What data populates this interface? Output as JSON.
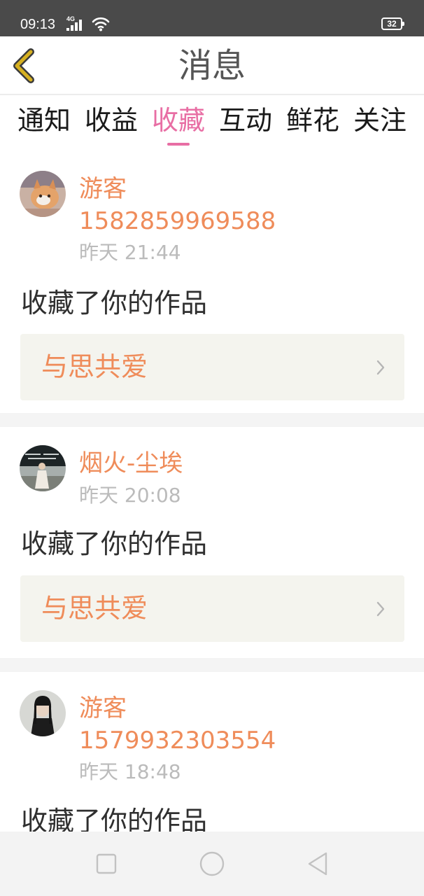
{
  "status_bar": {
    "time": "09:13",
    "network": "4G",
    "battery": "32",
    "icons": [
      "signal-icon",
      "wifi-icon",
      "battery-icon"
    ]
  },
  "header": {
    "title": "消息",
    "back_icon": "chevron-left-icon"
  },
  "tabs": [
    {
      "label": "通知",
      "active": false
    },
    {
      "label": "收益",
      "active": false
    },
    {
      "label": "收藏",
      "active": true
    },
    {
      "label": "互动",
      "active": false
    },
    {
      "label": "鲜花",
      "active": false
    },
    {
      "label": "关注",
      "active": false
    }
  ],
  "feed": [
    {
      "username": "游客",
      "user_id": "1582859969588",
      "timestamp": "昨天 21:44",
      "action": "收藏了你的作品",
      "work_title": "与思共爱",
      "avatar_icon": "cat-photo-avatar"
    },
    {
      "username": "烟火-尘埃",
      "timestamp": "昨天 20:08",
      "action": "收藏了你的作品",
      "work_title": "与思共爱",
      "avatar_icon": "girl-photo-avatar"
    },
    {
      "username": "游客",
      "user_id": "1579932303554",
      "timestamp": "昨天 18:48",
      "action": "收藏了你的作品",
      "avatar_icon": "man-photo-avatar"
    }
  ],
  "nav_bar": {
    "icons": [
      "recents-square-icon",
      "home-circle-icon",
      "back-triangle-icon"
    ]
  },
  "colors": {
    "accent_pink": "#e86ea4",
    "username_orange": "#ef8c5a",
    "back_arrow": "#d6b020",
    "timestamp_gray": "#bbbbbb",
    "card_bg": "#f4f4ee"
  }
}
